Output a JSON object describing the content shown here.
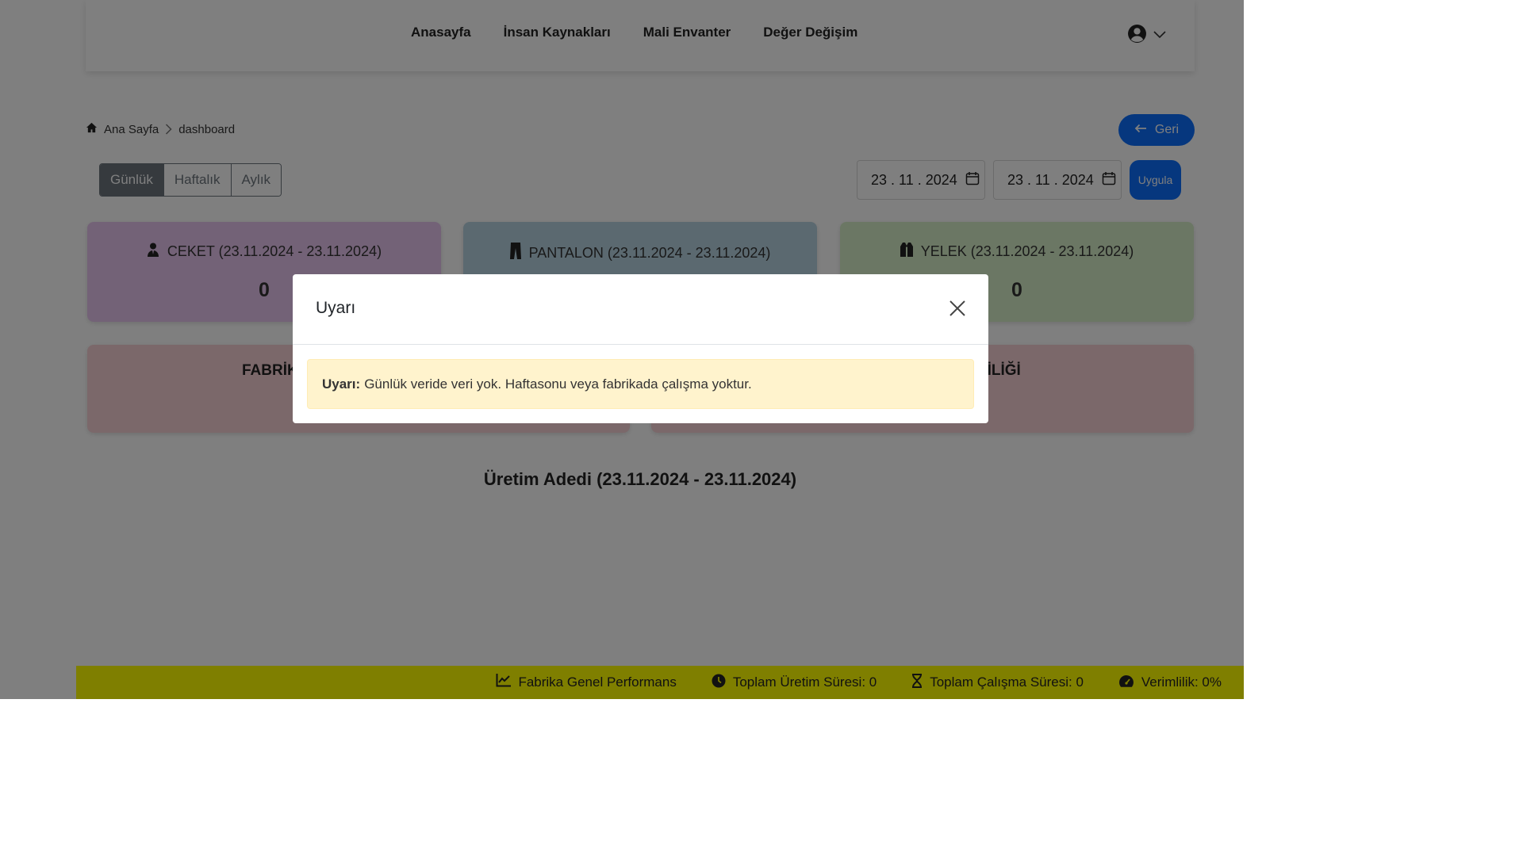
{
  "nav": {
    "links": [
      "Anasayfa",
      "İnsan Kaynakları",
      "Mali Envanter",
      "Değer Değişim"
    ],
    "user_icon": "user-circle-icon",
    "dropdown_icon": "chevron-down-icon"
  },
  "breadcrumb": {
    "home": "Ana Sayfa",
    "current": "dashboard"
  },
  "back_button": {
    "label": "Geri"
  },
  "period_tabs": {
    "items": [
      "Günlük",
      "Haftalık",
      "Aylık"
    ],
    "active": "Günlük"
  },
  "date_range": {
    "start": "23 . 11 . 2024",
    "end": "23 . 11 . 2024",
    "apply_label": "Uygula"
  },
  "cards": {
    "ceket": {
      "title": "CEKET (23.11.2024 - 23.11.2024)",
      "value": "0",
      "color": "#e7c5ee"
    },
    "pantalon": {
      "title": "PANTALON (23.11.2024 - 23.11.2024)",
      "value": "",
      "color": "#b7d3e0"
    },
    "yelek": {
      "title": "YELEK (23.11.2024 - 23.11.2024)",
      "value": "0",
      "color": "#d7eec9"
    },
    "fabrika_left": {
      "title": "FABRİK"
    },
    "fabrika_right": {
      "title": "LİLİĞİ"
    }
  },
  "section_title": "Üretim Adedi (23.11.2024 - 23.11.2024)",
  "footer": {
    "performance": "Fabrika Genel Performans",
    "production_time": "Toplam Üretim Süresi: 0",
    "work_time": "Toplam Çalışma Süresi: 0",
    "efficiency": "Verimlilik: 0%"
  },
  "modal": {
    "title": "Uyarı",
    "alert_strong": "Uyarı:",
    "alert_text": "Günlük veride veri yok. Haftasonu veya fabrikada çalışma yoktur."
  },
  "colors": {
    "primary": "#0d6efd",
    "footer": "#ffff00",
    "alert_bg": "#fff3cd"
  }
}
